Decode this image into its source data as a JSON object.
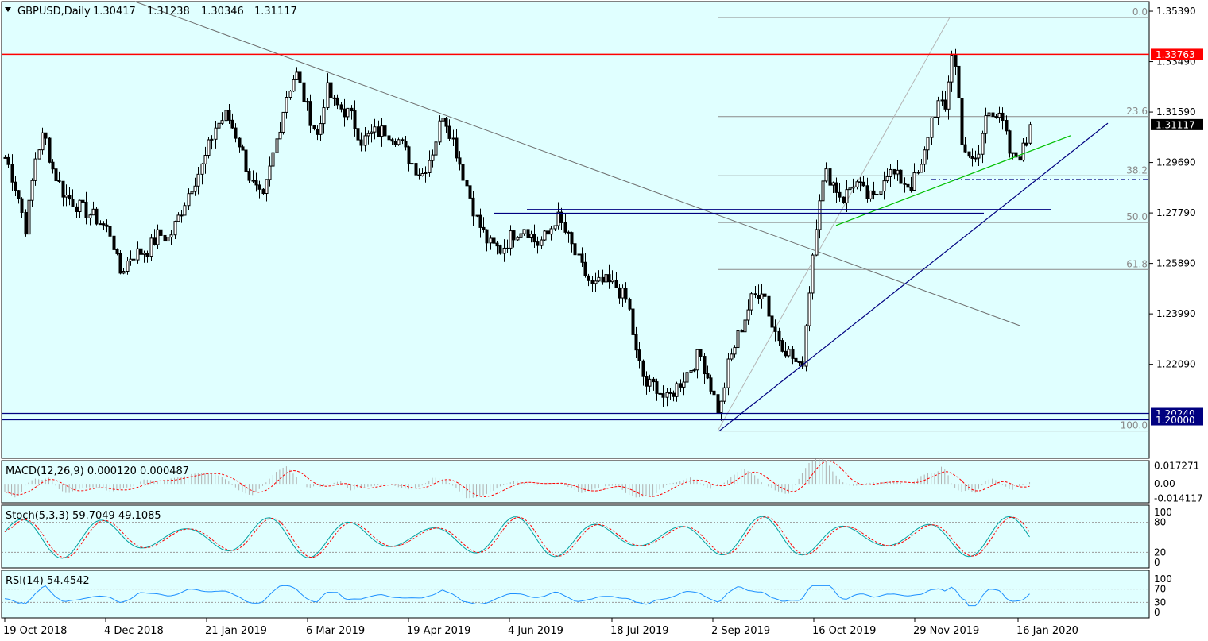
{
  "symbol": "GBPUSD",
  "timeframe": "Daily",
  "header": {
    "label": "GBPUSD,Daily",
    "open": "1.30417",
    "high": "1.31238",
    "low": "1.30346",
    "close": "1.31117"
  },
  "colors": {
    "background": "#e0ffff",
    "candle": "#000000",
    "resistance_line": "#ff0000",
    "support_line": "#000080",
    "green_trendline": "#00c000",
    "fib_lines": "#8a8a8a",
    "macd_signal": "#ff0000",
    "stoch_main": "#00a0a0",
    "stoch_signal": "#ff0000",
    "rsi_line": "#1e90ff"
  },
  "chart_data": [
    {
      "type": "candlestick",
      "panel": "main",
      "title": "GBPUSD,Daily",
      "ylim": [
        1.1855,
        1.3575
      ],
      "price_ticks": [
        "1.35390",
        "1.33490",
        "1.31590",
        "1.29690",
        "1.27790",
        "1.25890",
        "1.23990",
        "1.22090"
      ],
      "date_labels": [
        "19 Oct 2018",
        "4 Dec 2018",
        "21 Jan 2019",
        "6 Mar 2019",
        "19 Apr 2019",
        "4 Jun 2019",
        "18 Jul 2019",
        "2 Sep 2019",
        "16 Oct 2019",
        "29 Nov 2019",
        "16 Jan 2020"
      ],
      "price_markers": [
        {
          "label": "1.33763",
          "value": 1.33763,
          "color": "#ff0000"
        },
        {
          "label": "1.31117",
          "value": 1.31117,
          "color": "#000000"
        },
        {
          "label": "1.20240",
          "value": 1.2024,
          "color": "#000080"
        },
        {
          "label": "1.20000",
          "value": 1.2,
          "color": "#000080"
        }
      ],
      "fibonacci": [
        {
          "label": "0.0",
          "value": 1.3515
        },
        {
          "label": "23.6",
          "value": 1.3142
        },
        {
          "label": "38.2",
          "value": 1.2919
        },
        {
          "label": "50.0",
          "value": 1.2743
        },
        {
          "label": "61.8",
          "value": 1.2566
        },
        {
          "label": "100.0",
          "value": 1.1958
        }
      ],
      "horizontal_levels": [
        {
          "name": "resistance",
          "value": 1.33763
        },
        {
          "name": "support-1",
          "value": 1.2024
        },
        {
          "name": "support-2",
          "value": 1.2
        },
        {
          "name": "dash-dot",
          "value": 1.2905
        },
        {
          "name": "zone-upper",
          "value": 1.2792
        },
        {
          "name": "zone-lower",
          "value": 1.2778
        }
      ],
      "last_candle": {
        "open": 1.30417,
        "high": 1.31238,
        "low": 1.30346,
        "close": 1.31117
      }
    },
    {
      "type": "line",
      "panel": "MACD",
      "label": "MACD(12,26,9) 0.000120 0.000487",
      "ticks": [
        "0.017271",
        "0.00",
        "-0.014117"
      ],
      "ylim": [
        -0.0175,
        0.0215
      ]
    },
    {
      "type": "line",
      "panel": "Stochastic",
      "label": "Stoch(5,3,3) 59.7049 49.1085",
      "ticks": [
        "100",
        "80",
        "20",
        "0"
      ],
      "ylim": [
        0,
        100
      ]
    },
    {
      "type": "line",
      "panel": "RSI",
      "label": "RSI(14) 54.4542",
      "ticks": [
        "100",
        "70",
        "30",
        "0"
      ],
      "ylim": [
        0,
        100
      ]
    }
  ]
}
